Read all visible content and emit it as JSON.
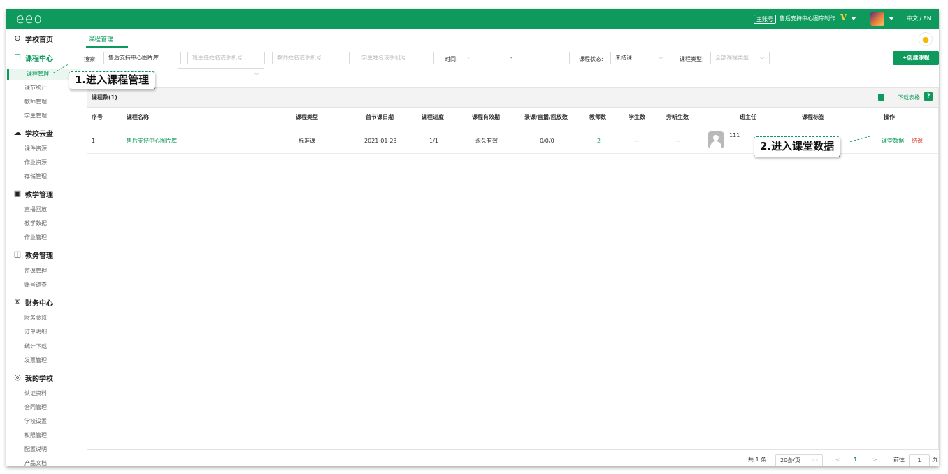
{
  "header": {
    "logo": "eeo",
    "account_badge": "主账号",
    "account_name": "售后支持中心图库制作",
    "vip": "V",
    "language": "中文 / EN"
  },
  "sidebar": {
    "groups": [
      {
        "icon": "⊙",
        "label": "学校首页",
        "items": []
      },
      {
        "icon": "☐",
        "label": "课程中心",
        "items": [
          "课程管理",
          "课节统计",
          "教师管理",
          "学生管理"
        ]
      },
      {
        "icon": "☁",
        "label": "学校云盘",
        "items": [
          "课件资源",
          "作业资源",
          "存储管理"
        ]
      },
      {
        "icon": "▣",
        "label": "教学管理",
        "items": [
          "直播回放",
          "教学数据",
          "作业管理"
        ]
      },
      {
        "icon": "◫",
        "label": "教务管理",
        "items": [
          "监课管理",
          "账号速查"
        ]
      },
      {
        "icon": "®",
        "label": "财务中心",
        "items": [
          "财务总览",
          "订单明细",
          "统计下载",
          "发票管理"
        ]
      },
      {
        "icon": "◎",
        "label": "我的学校",
        "items": [
          "认证资料",
          "合同管理",
          "学校设置",
          "权限管理",
          "配置说明",
          "产品文档"
        ]
      }
    ]
  },
  "tab": "课程管理",
  "filters": {
    "search_label": "搜索:",
    "search_value": "售后支持中心图片库",
    "teacher_ph": "班主任姓名或手机号",
    "lecturer_ph": "教师姓名或手机号",
    "student_ph": "学生姓名或手机号",
    "time_label": "时间:",
    "time_sep": "-",
    "status_label": "课程状态:",
    "status_value": "未结课",
    "type_label": "课程类型:",
    "type_ph": "全部课程类型",
    "create_button": "+创建课程"
  },
  "table": {
    "count": "课程数(1)",
    "download": "下载表格",
    "help": "?",
    "headers": [
      "序号",
      "课程名称",
      "课程类型",
      "首节课日期",
      "课程进度",
      "课程有效期",
      "录课/直播/回放数",
      "教师数",
      "学生数",
      "旁听生数",
      "班主任",
      "课程标签",
      "操作"
    ],
    "rows": [
      {
        "index": "1",
        "name": "售后支持中心图片库",
        "type": "标准课",
        "first_date": "2021-01-23",
        "progress": "1/1",
        "validity": "永久有效",
        "recordings": "0/0/0",
        "teachers": "2",
        "students": "--",
        "auditors": "--",
        "head_teacher": "111",
        "action_data": "课堂数据",
        "action_end": "结课"
      }
    ]
  },
  "pagination": {
    "total": "共 1 条",
    "per_page": "20条/页",
    "prev": "<",
    "page": "1",
    "next": ">",
    "goto_label": "前往",
    "goto_value": "1",
    "page_suffix": "页"
  },
  "callouts": {
    "step1": "1.进入课程管理",
    "step2": "2.进入课堂数据"
  },
  "colors": {
    "brand_green": "#0e9a5c",
    "danger_red": "#e0493b"
  }
}
